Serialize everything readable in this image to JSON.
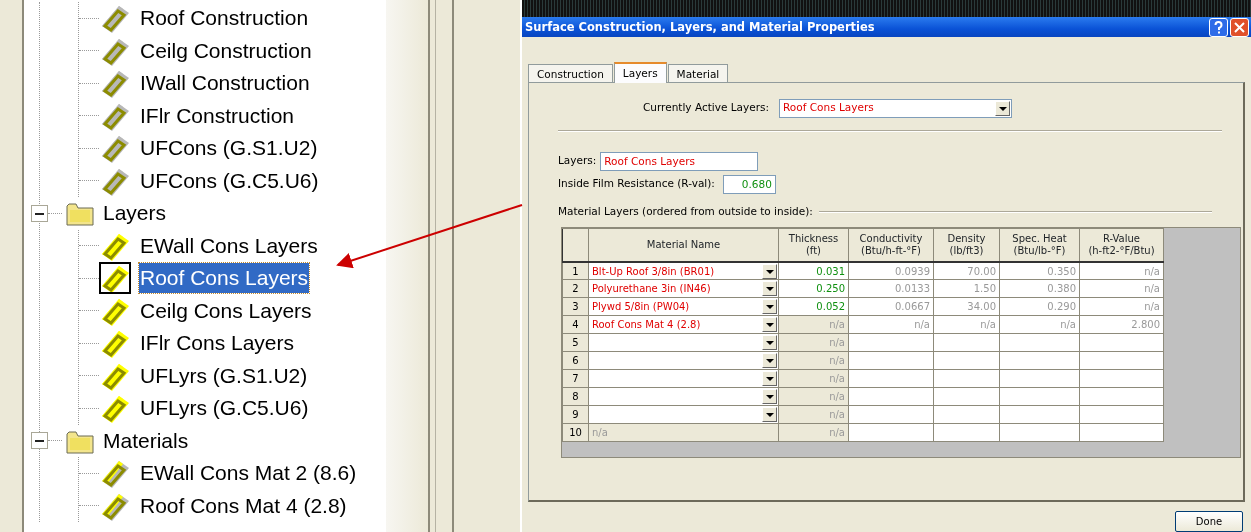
{
  "tree": {
    "continued_items": [
      {
        "label": "Roof Construction",
        "kind": "construction",
        "selected": false
      },
      {
        "label": "Ceilg Construction",
        "kind": "construction",
        "selected": false
      },
      {
        "label": "IWall Construction",
        "kind": "construction",
        "selected": false
      },
      {
        "label": "IFlr Construction",
        "kind": "construction",
        "selected": false
      },
      {
        "label": "UFCons (G.S1.U2)",
        "kind": "construction",
        "selected": false
      },
      {
        "label": "UFCons (G.C5.U6)",
        "kind": "construction",
        "selected": false
      }
    ],
    "folders": [
      {
        "label": "Layers",
        "expanded": true,
        "children": [
          {
            "label": "EWall Cons Layers",
            "kind": "layers",
            "selected": false
          },
          {
            "label": "Roof Cons Layers",
            "kind": "layers",
            "selected": true
          },
          {
            "label": "Ceilg Cons Layers",
            "kind": "layers",
            "selected": false
          },
          {
            "label": "IFlr Cons Layers",
            "kind": "layers",
            "selected": false
          },
          {
            "label": "UFLyrs (G.S1.U2)",
            "kind": "layers",
            "selected": false
          },
          {
            "label": "UFLyrs (G.C5.U6)",
            "kind": "layers",
            "selected": false
          }
        ]
      },
      {
        "label": "Materials",
        "expanded": true,
        "children": [
          {
            "label": "EWall Cons Mat 2 (8.6)",
            "kind": "material",
            "selected": false
          },
          {
            "label": "Roof Cons Mat 4 (2.8)",
            "kind": "material",
            "selected": false
          }
        ]
      }
    ]
  },
  "dialog": {
    "title": "Surface Construction, Layers, and Material Properties",
    "tabs": [
      {
        "label": "Construction",
        "selected": false
      },
      {
        "label": "Layers",
        "selected": true
      },
      {
        "label": "Material",
        "selected": false
      }
    ],
    "active_layers": {
      "label": "Currently Active Layers:",
      "value": "Roof Cons Layers"
    },
    "layers_field": {
      "label": "Layers:",
      "value": "Roof Cons Layers"
    },
    "film_field": {
      "label": "Inside Film Resistance (R-val):",
      "value": "0.680"
    },
    "section_label": "Material Layers (ordered from outside to inside):",
    "grid": {
      "columns": [
        "Material Name",
        "Thickness\n(ft)",
        "Conductivity\n(Btu/h-ft-°F)",
        "Density\n(lb/ft3)",
        "Spec. Heat\n(Btu/lb-°F)",
        "R-Value\n(h-ft2-°F/Btu)"
      ],
      "rows": [
        {
          "number": "1",
          "kind": "material",
          "cells": [
            "Blt-Up Roof 3/8in (BR01)",
            "0.031",
            "0.0939",
            "70.00",
            "0.350",
            "n/a"
          ]
        },
        {
          "number": "2",
          "kind": "material",
          "cells": [
            "Polyurethane 3in (IN46)",
            "0.250",
            "0.0133",
            "1.50",
            "0.380",
            "n/a"
          ]
        },
        {
          "number": "3",
          "kind": "material",
          "cells": [
            "Plywd 5/8in (PW04)",
            "0.052",
            "0.0667",
            "34.00",
            "0.290",
            "n/a"
          ]
        },
        {
          "number": "4",
          "kind": "layer",
          "cells": [
            "Roof Cons Mat 4 (2.8)",
            "n/a",
            "n/a",
            "n/a",
            "n/a",
            "2.800"
          ]
        },
        {
          "number": "5",
          "kind": "empty",
          "cells": [
            "",
            "n/a",
            "",
            "",
            "",
            ""
          ]
        },
        {
          "number": "6",
          "kind": "empty",
          "cells": [
            "",
            "n/a",
            "",
            "",
            "",
            ""
          ]
        },
        {
          "number": "7",
          "kind": "empty",
          "cells": [
            "",
            "n/a",
            "",
            "",
            "",
            ""
          ]
        },
        {
          "number": "8",
          "kind": "empty",
          "cells": [
            "",
            "n/a",
            "",
            "",
            "",
            ""
          ]
        },
        {
          "number": "9",
          "kind": "empty",
          "cells": [
            "",
            "n/a",
            "",
            "",
            "",
            ""
          ]
        },
        {
          "number": "10",
          "kind": "locked",
          "cells": [
            "n/a",
            "n/a",
            "",
            "",
            "",
            ""
          ]
        }
      ]
    },
    "buttons": [
      "Done"
    ]
  }
}
